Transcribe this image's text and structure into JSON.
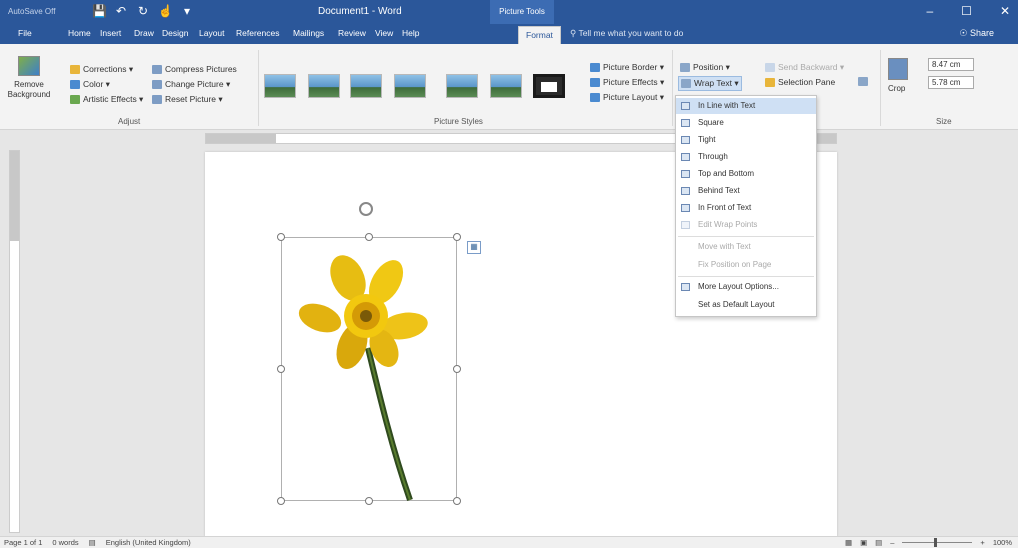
{
  "titlebar": {
    "autosave": "AutoSave  Off",
    "doc_title": "Document1 - Word",
    "context_tools": "Picture Tools",
    "min": "–",
    "max": "☐",
    "close": "✕"
  },
  "tabs": [
    {
      "label": "File"
    },
    {
      "label": "Home"
    },
    {
      "label": "Insert"
    },
    {
      "label": "Draw"
    },
    {
      "label": "Design"
    },
    {
      "label": "Layout"
    },
    {
      "label": "References"
    },
    {
      "label": "Mailings"
    },
    {
      "label": "Review"
    },
    {
      "label": "View"
    },
    {
      "label": "Help"
    },
    {
      "label": "Format"
    }
  ],
  "tell_me": "Tell me what you want to do",
  "share": "Share",
  "ribbon": {
    "remove_background": "Remove Background",
    "corrections": "Corrections ▾",
    "color": "Color ▾",
    "artistic_effects": "Artistic Effects ▾",
    "compress": "Compress Pictures",
    "change": "Change Picture ▾",
    "reset": "Reset Picture ▾",
    "adjust_label": "Adjust",
    "styles_label": "Picture Styles",
    "picture_border": "Picture Border ▾",
    "picture_effects": "Picture Effects ▾",
    "picture_layout": "Picture Layout ▾",
    "position": "Position ▾",
    "wrap_text": "Wrap Text ▾",
    "send_backward": "Send Backward ▾",
    "selection_pane": "Selection Pane",
    "crop": "Crop",
    "height": "8.47 cm",
    "width": "5.78 cm",
    "size_label": "Size"
  },
  "wrap_menu": {
    "items": [
      {
        "label": "In Line with Text",
        "state": "highlighted"
      },
      {
        "label": "Square",
        "state": "normal"
      },
      {
        "label": "Tight",
        "state": "normal"
      },
      {
        "label": "Through",
        "state": "normal"
      },
      {
        "label": "Top and Bottom",
        "state": "normal"
      },
      {
        "label": "Behind Text",
        "state": "normal"
      },
      {
        "label": "In Front of Text",
        "state": "normal"
      },
      {
        "label": "Edit Wrap Points",
        "state": "disabled"
      },
      {
        "label": "Move with Text",
        "state": "disabled"
      },
      {
        "label": "Fix Position on Page",
        "state": "disabled"
      },
      {
        "label": "More Layout Options...",
        "state": "normal"
      },
      {
        "label": "Set as Default Layout",
        "state": "normal"
      }
    ]
  },
  "statusbar": {
    "page": "Page 1 of 1",
    "words": "0 words",
    "language": "English (United Kingdom)",
    "zoom_minus": "–",
    "zoom_plus": "+",
    "zoom": "100%"
  },
  "colors": {
    "accent": "#2b579a",
    "menu_highlight": "#cfe0f4",
    "daffodil_yellow": "#f2c80f"
  }
}
